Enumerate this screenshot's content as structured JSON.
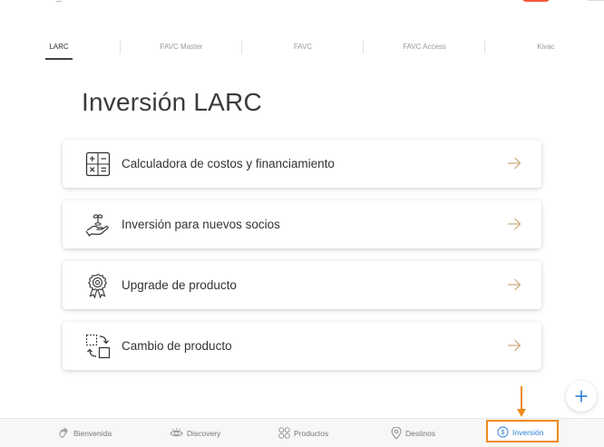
{
  "tabs": [
    {
      "label": "LARC",
      "active": true
    },
    {
      "label": "FAVC Master",
      "active": false
    },
    {
      "label": "FAVC",
      "active": false
    },
    {
      "label": "FAVC Access",
      "active": false
    },
    {
      "label": "Kivac",
      "active": false
    }
  ],
  "page": {
    "title": "Inversión LARC"
  },
  "cards": [
    {
      "label": "Calculadora de costos y financiamiento",
      "icon": "calculator-icon"
    },
    {
      "label": "Inversión para nuevos socios",
      "icon": "hand-sprout-icon"
    },
    {
      "label": "Upgrade de producto",
      "icon": "award-ribbon-icon"
    },
    {
      "label": "Cambio de producto",
      "icon": "swap-frame-icon"
    }
  ],
  "fab": {
    "icon": "plus-icon"
  },
  "bottom_nav": [
    {
      "label": "Bienvenida",
      "icon": "hand-wave-icon",
      "active": false
    },
    {
      "label": "Discovery",
      "icon": "eye-icon",
      "active": false
    },
    {
      "label": "Productos",
      "icon": "grid-icon",
      "active": false
    },
    {
      "label": "Destinos",
      "icon": "map-pin-icon",
      "active": false
    },
    {
      "label": "Inversión",
      "icon": "dollar-circle-icon",
      "active": true
    }
  ],
  "colors": {
    "accent_arrow": "#c9a878",
    "active_nav": "#2a7fd4",
    "highlight": "#f08a1c"
  }
}
